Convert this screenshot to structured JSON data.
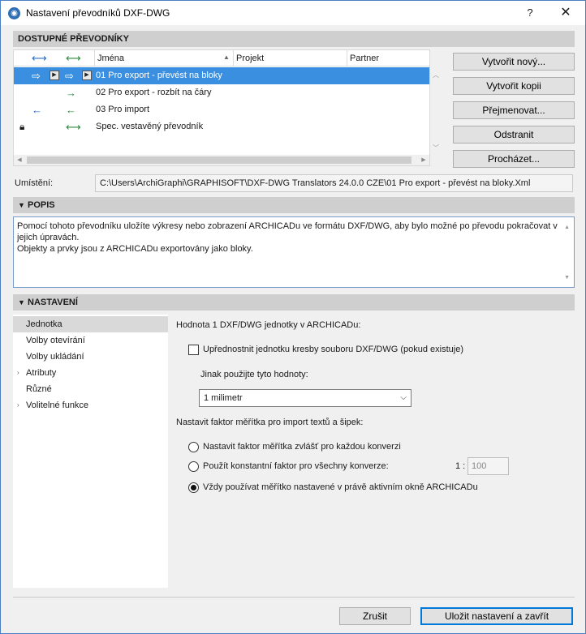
{
  "window": {
    "title": "Nastavení převodníků DXF-DWG",
    "help": "?",
    "close": "✕"
  },
  "sections": {
    "available": "DOSTUPNÉ PŘEVODNÍKY",
    "description": "POPIS",
    "settings": "NASTAVENÍ"
  },
  "list": {
    "columns": [
      "Jména",
      "Projekt",
      "Partner"
    ],
    "rows": [
      {
        "name": "01 Pro export - převést na bloky",
        "selected": true
      },
      {
        "name": "02 Pro export - rozbít na čáry",
        "selected": false
      },
      {
        "name": "03 Pro import",
        "selected": false
      },
      {
        "name": "Spec. vestavěný převodník",
        "selected": false
      }
    ]
  },
  "buttons": {
    "new": "Vytvořit nový...",
    "copy": "Vytvořit kopii",
    "rename": "Přejmenovat...",
    "delete": "Odstranit",
    "browse": "Procházet...",
    "cancel": "Zrušit",
    "save_close": "Uložit nastavení a zavřít"
  },
  "location": {
    "label": "Umístění:",
    "path": "C:\\Users\\ArchiGraphi\\GRAPHISOFT\\DXF-DWG Translators 24.0.0 CZE\\01 Pro export - převést na bloky.Xml"
  },
  "description": {
    "line1": "Pomocí tohoto převodníku uložíte výkresy nebo zobrazení ARCHICADu ve formátu DXF/DWG, aby bylo možné po převodu pokračovat v jejich úpravách.",
    "line2": "Objekty a prvky jsou z ARCHICADu exportovány jako bloky."
  },
  "nav": {
    "items": [
      "Jednotka",
      "Volby otevírání",
      "Volby ukládání",
      "Atributy",
      "Různé",
      "Volitelné funkce"
    ]
  },
  "unit_panel": {
    "heading": "Hodnota 1 DXF/DWG jednotky v ARCHICADu:",
    "prefer_label": "Upřednostnit jednotku kresby souboru DXF/DWG (pokud existuje)",
    "prefer_checked": false,
    "otherwise_label": "Jinak použijte tyto hodnoty:",
    "unit_value": "1 milimetr",
    "scale_heading": "Nastavit faktor měřítka pro import textů a šipek:",
    "radio_each": "Nastavit faktor měřítka zvlášť pro každou konverzi",
    "radio_constant": "Použít konstantní faktor pro všechny konverze:",
    "radio_active": "Vždy používat měřítko nastavené v právě aktivním okně ARCHICADu",
    "scale_prefix": "1 :",
    "scale_value": "100"
  }
}
